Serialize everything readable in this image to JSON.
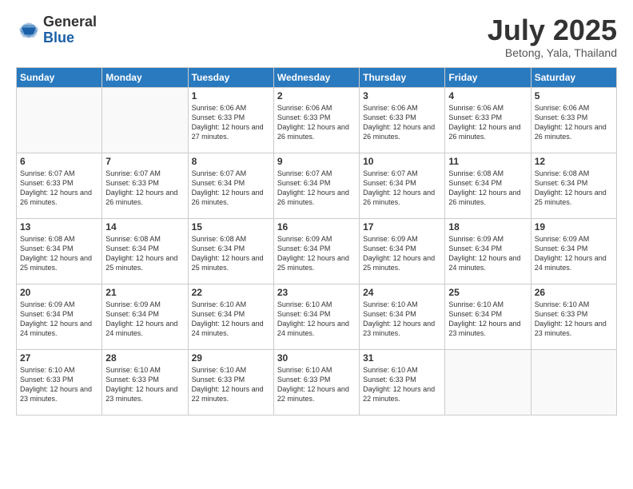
{
  "logo": {
    "general": "General",
    "blue": "Blue"
  },
  "title": "July 2025",
  "location": "Betong, Yala, Thailand",
  "days_of_week": [
    "Sunday",
    "Monday",
    "Tuesday",
    "Wednesday",
    "Thursday",
    "Friday",
    "Saturday"
  ],
  "weeks": [
    [
      {
        "day": "",
        "info": ""
      },
      {
        "day": "",
        "info": ""
      },
      {
        "day": "1",
        "info": "Sunrise: 6:06 AM\nSunset: 6:33 PM\nDaylight: 12 hours and 27 minutes."
      },
      {
        "day": "2",
        "info": "Sunrise: 6:06 AM\nSunset: 6:33 PM\nDaylight: 12 hours and 26 minutes."
      },
      {
        "day": "3",
        "info": "Sunrise: 6:06 AM\nSunset: 6:33 PM\nDaylight: 12 hours and 26 minutes."
      },
      {
        "day": "4",
        "info": "Sunrise: 6:06 AM\nSunset: 6:33 PM\nDaylight: 12 hours and 26 minutes."
      },
      {
        "day": "5",
        "info": "Sunrise: 6:06 AM\nSunset: 6:33 PM\nDaylight: 12 hours and 26 minutes."
      }
    ],
    [
      {
        "day": "6",
        "info": "Sunrise: 6:07 AM\nSunset: 6:33 PM\nDaylight: 12 hours and 26 minutes."
      },
      {
        "day": "7",
        "info": "Sunrise: 6:07 AM\nSunset: 6:33 PM\nDaylight: 12 hours and 26 minutes."
      },
      {
        "day": "8",
        "info": "Sunrise: 6:07 AM\nSunset: 6:34 PM\nDaylight: 12 hours and 26 minutes."
      },
      {
        "day": "9",
        "info": "Sunrise: 6:07 AM\nSunset: 6:34 PM\nDaylight: 12 hours and 26 minutes."
      },
      {
        "day": "10",
        "info": "Sunrise: 6:07 AM\nSunset: 6:34 PM\nDaylight: 12 hours and 26 minutes."
      },
      {
        "day": "11",
        "info": "Sunrise: 6:08 AM\nSunset: 6:34 PM\nDaylight: 12 hours and 26 minutes."
      },
      {
        "day": "12",
        "info": "Sunrise: 6:08 AM\nSunset: 6:34 PM\nDaylight: 12 hours and 25 minutes."
      }
    ],
    [
      {
        "day": "13",
        "info": "Sunrise: 6:08 AM\nSunset: 6:34 PM\nDaylight: 12 hours and 25 minutes."
      },
      {
        "day": "14",
        "info": "Sunrise: 6:08 AM\nSunset: 6:34 PM\nDaylight: 12 hours and 25 minutes."
      },
      {
        "day": "15",
        "info": "Sunrise: 6:08 AM\nSunset: 6:34 PM\nDaylight: 12 hours and 25 minutes."
      },
      {
        "day": "16",
        "info": "Sunrise: 6:09 AM\nSunset: 6:34 PM\nDaylight: 12 hours and 25 minutes."
      },
      {
        "day": "17",
        "info": "Sunrise: 6:09 AM\nSunset: 6:34 PM\nDaylight: 12 hours and 25 minutes."
      },
      {
        "day": "18",
        "info": "Sunrise: 6:09 AM\nSunset: 6:34 PM\nDaylight: 12 hours and 24 minutes."
      },
      {
        "day": "19",
        "info": "Sunrise: 6:09 AM\nSunset: 6:34 PM\nDaylight: 12 hours and 24 minutes."
      }
    ],
    [
      {
        "day": "20",
        "info": "Sunrise: 6:09 AM\nSunset: 6:34 PM\nDaylight: 12 hours and 24 minutes."
      },
      {
        "day": "21",
        "info": "Sunrise: 6:09 AM\nSunset: 6:34 PM\nDaylight: 12 hours and 24 minutes."
      },
      {
        "day": "22",
        "info": "Sunrise: 6:10 AM\nSunset: 6:34 PM\nDaylight: 12 hours and 24 minutes."
      },
      {
        "day": "23",
        "info": "Sunrise: 6:10 AM\nSunset: 6:34 PM\nDaylight: 12 hours and 24 minutes."
      },
      {
        "day": "24",
        "info": "Sunrise: 6:10 AM\nSunset: 6:34 PM\nDaylight: 12 hours and 23 minutes."
      },
      {
        "day": "25",
        "info": "Sunrise: 6:10 AM\nSunset: 6:34 PM\nDaylight: 12 hours and 23 minutes."
      },
      {
        "day": "26",
        "info": "Sunrise: 6:10 AM\nSunset: 6:33 PM\nDaylight: 12 hours and 23 minutes."
      }
    ],
    [
      {
        "day": "27",
        "info": "Sunrise: 6:10 AM\nSunset: 6:33 PM\nDaylight: 12 hours and 23 minutes."
      },
      {
        "day": "28",
        "info": "Sunrise: 6:10 AM\nSunset: 6:33 PM\nDaylight: 12 hours and 23 minutes."
      },
      {
        "day": "29",
        "info": "Sunrise: 6:10 AM\nSunset: 6:33 PM\nDaylight: 12 hours and 22 minutes."
      },
      {
        "day": "30",
        "info": "Sunrise: 6:10 AM\nSunset: 6:33 PM\nDaylight: 12 hours and 22 minutes."
      },
      {
        "day": "31",
        "info": "Sunrise: 6:10 AM\nSunset: 6:33 PM\nDaylight: 12 hours and 22 minutes."
      },
      {
        "day": "",
        "info": ""
      },
      {
        "day": "",
        "info": ""
      }
    ]
  ]
}
